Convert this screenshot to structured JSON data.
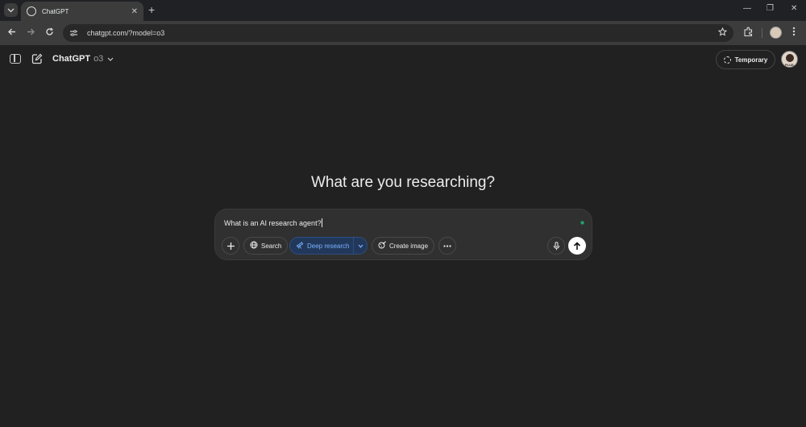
{
  "browser": {
    "tab_title": "ChatGPT",
    "url": "chatgpt.com/?model=o3",
    "tab_close": "✕",
    "new_tab": "+",
    "minimize": "—",
    "restore": "❐",
    "close": "✕"
  },
  "header": {
    "app_name": "ChatGPT",
    "model_version": "o3",
    "temporary_label": "Temporary",
    "avatar_badge": "PLUS"
  },
  "main": {
    "heading": "What are you researching?"
  },
  "composer": {
    "input_value": "What is an AI research agent?",
    "tools": {
      "search_label": "Search",
      "deep_research_label": "Deep research",
      "create_image_label": "Create image"
    }
  },
  "colors": {
    "background": "#212121",
    "composer": "#303030",
    "deep_research_bg": "#22385a",
    "deep_research_text": "#79b0ff",
    "status_dot": "#2ea572"
  },
  "icons": [
    "tab-list-icon",
    "globe-favicon-icon",
    "back-icon",
    "forward-icon",
    "reload-icon",
    "site-info-icon",
    "star-icon",
    "extensions-icon",
    "menu-icon",
    "sidebar-icon",
    "new-chat-icon",
    "chevron-down-icon",
    "temporary-chat-icon",
    "plus-icon",
    "globe-icon",
    "telescope-icon",
    "palette-icon",
    "more-icon",
    "mic-icon",
    "arrow-up-icon"
  ]
}
